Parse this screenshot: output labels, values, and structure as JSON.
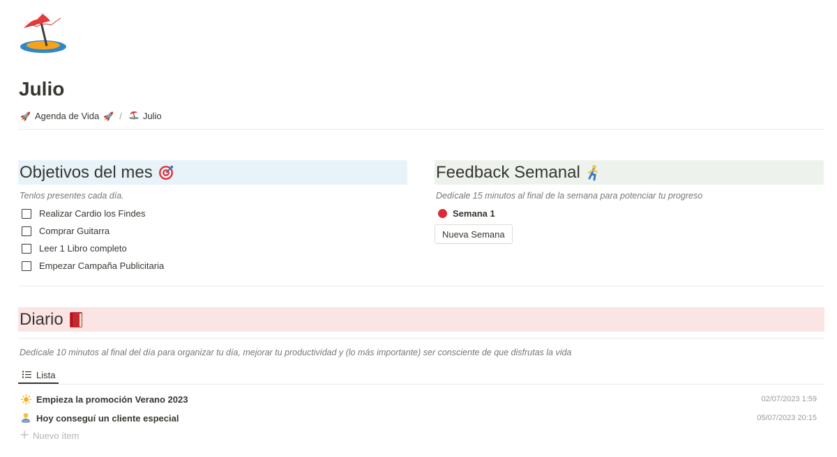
{
  "page": {
    "icon": "beach-umbrella-icon",
    "title": "Julio"
  },
  "breadcrumb": [
    {
      "icon": "rocket-icon",
      "label": "Agenda de Vida",
      "trailing_icon": "rocket-icon"
    },
    {
      "icon": "beach-umbrella-icon",
      "label": "Julio"
    }
  ],
  "breadcrumb_separator": "/",
  "objectives": {
    "heading": "Objetivos del mes",
    "heading_icon": "target-icon",
    "background": "#e7f3f8",
    "subtitle": "Tenlos presentes cada día.",
    "items": [
      {
        "label": "Realizar Cardio los Findes",
        "checked": false
      },
      {
        "label": "Comprar Guitarra",
        "checked": false
      },
      {
        "label": "Leer 1 Libro completo",
        "checked": false
      },
      {
        "label": "Empezar Campaña Publicitaria",
        "checked": false
      }
    ]
  },
  "feedback": {
    "heading": "Feedback Semanal",
    "heading_icon": "runner-icon",
    "background": "#edf3ec",
    "subtitle": "Dedícale 15 minutos al final de la semana para potenciar tu progreso",
    "week_item": {
      "label": "Semana 1",
      "icon": "red-circle-icon"
    },
    "button_label": "Nueva Semana"
  },
  "diario": {
    "heading": "Diario",
    "heading_icon": "red-book-icon",
    "background": "#fbe4e4",
    "subtitle": "Dedícale 10 minutos al final del día para organizar tu día, mejorar tu productividad y (lo más importante) ser consciente de que disfrutas la vida",
    "view_tab": {
      "label": "Lista",
      "icon": "list-icon"
    },
    "rows": [
      {
        "icon": "sun-icon",
        "title": "Empieza la promoción Verano 2023",
        "date": "02/07/2023 1:59"
      },
      {
        "icon": "person-laptop-icon",
        "title": "Hoy conseguí un cliente especial",
        "date": "05/07/2023 20:15"
      }
    ],
    "new_item_label": "Nuevo ítem"
  }
}
